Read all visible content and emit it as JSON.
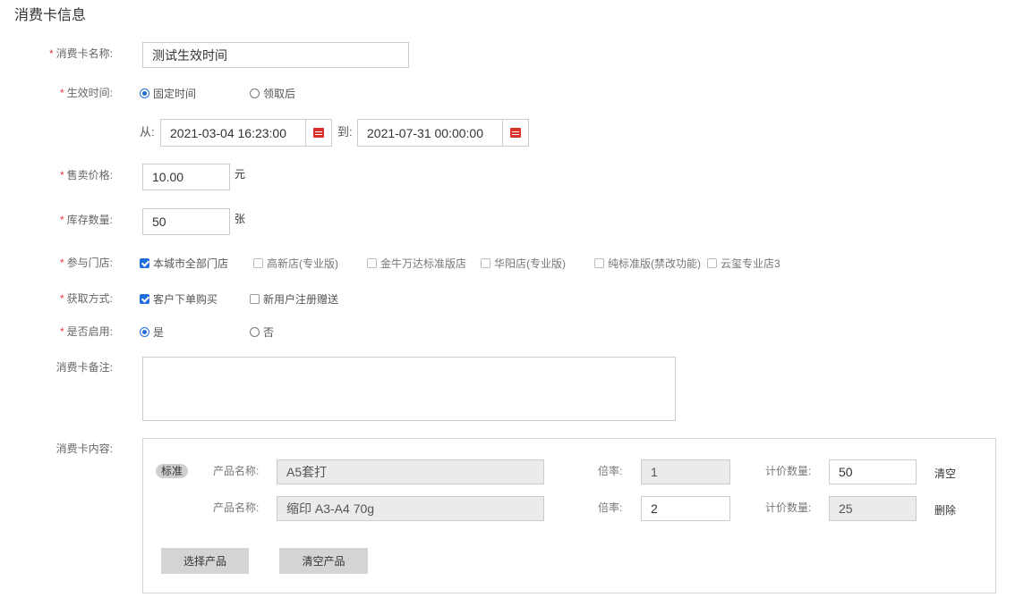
{
  "title": "消费卡信息",
  "fields": {
    "name": {
      "label": "消费卡名称:",
      "value": "测试生效时间"
    },
    "effective": {
      "label": "生效时间:",
      "options": [
        "固定时间",
        "领取后"
      ],
      "from_label": "从:",
      "from": "2021-03-04 16:23:00",
      "to_label": "到:",
      "to": "2021-07-31 00:00:00"
    },
    "price": {
      "label": "售卖价格:",
      "value": "10.00",
      "unit": "元"
    },
    "stock": {
      "label": "库存数量:",
      "value": "50",
      "unit": "张"
    },
    "stores": {
      "label": "参与门店:",
      "options": [
        "本城市全部门店",
        "高新店(专业版)",
        "金牛万达标准版店",
        "华阳店(专业版)",
        "纯标准版(禁改功能)",
        "云玺专业店3"
      ]
    },
    "method": {
      "label": "获取方式:",
      "options": [
        "客户下单购买",
        "新用户注册赠送"
      ]
    },
    "enabled": {
      "label": "是否启用:",
      "options": [
        "是",
        "否"
      ]
    },
    "remark": {
      "label": "消费卡备注:",
      "value": ""
    },
    "content": {
      "label": "消费卡内容:",
      "tag": "标准",
      "rows": [
        {
          "name_label": "产品名称:",
          "name": "A5套打",
          "ratio_label": "倍率:",
          "ratio": "1",
          "qty_label": "计价数量:",
          "qty": "50",
          "action": "清空"
        },
        {
          "name_label": "产品名称:",
          "name": "缩印 A3-A4 70g",
          "ratio_label": "倍率:",
          "ratio": "2",
          "qty_label": "计价数量:",
          "qty": "25",
          "action": "删除"
        }
      ],
      "select_btn": "选择产品",
      "clear_btn": "清空产品"
    }
  },
  "colors": {
    "accent": "#1e6fd9",
    "required": "#e4393c",
    "calendar": "#d9302c"
  }
}
